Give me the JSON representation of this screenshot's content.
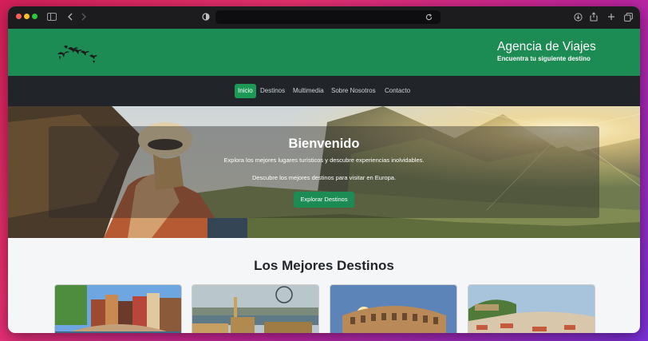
{
  "header": {
    "title": "Agencia de Viajes",
    "subtitle": "Encuentra tu siguiente destino"
  },
  "nav": {
    "items": [
      {
        "label": "Inicio",
        "active": true
      },
      {
        "label": "Destinos"
      },
      {
        "label": "Multimedia"
      },
      {
        "label": "Sobre Nosotros"
      },
      {
        "label": "Contacto"
      }
    ]
  },
  "hero": {
    "heading": "Bienvenido",
    "line1": "Explora los mejores lugares turísticos y descubre experiencias inolvidables.",
    "line2": "Descubre los mejores destinos para visitar en Europa.",
    "button_label": "Explorar Destinos"
  },
  "destinations": {
    "title": "Los Mejores Destinos",
    "cards": [
      {
        "image": "amsterdam-canal-photo"
      },
      {
        "image": "london-thames-photo"
      },
      {
        "image": "rome-colosseum-photo"
      },
      {
        "image": "lisbon-city-photo"
      }
    ]
  },
  "colors": {
    "brand_green": "#1c8b54",
    "nav_dark": "#212529",
    "active_green": "#1c9a55"
  },
  "icons": [
    "sidebar-icon",
    "back-icon",
    "forward-icon",
    "privacy-shield-icon",
    "reload-icon",
    "download-icon",
    "share-icon",
    "new-tab-icon",
    "tabs-overview-icon",
    "birds-logo"
  ]
}
